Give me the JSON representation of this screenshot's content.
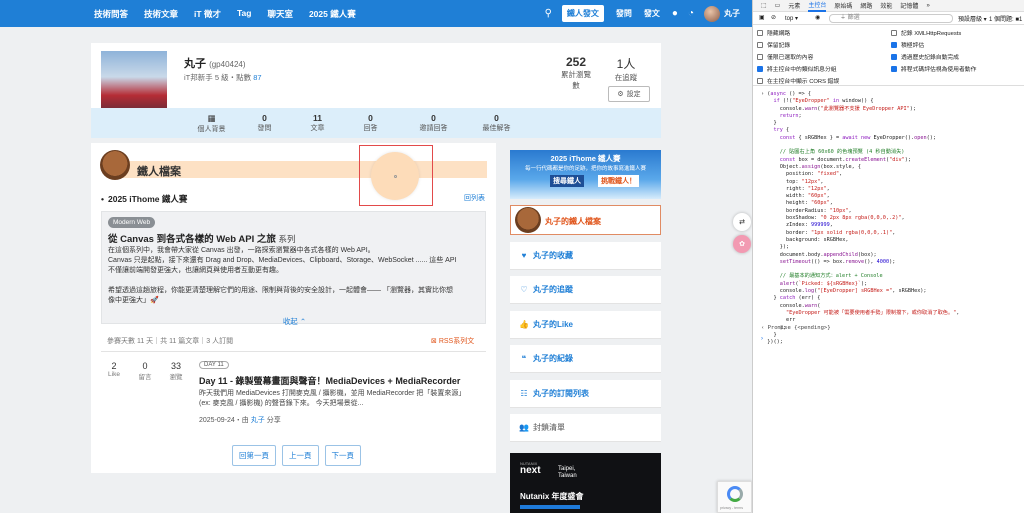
{
  "nav": {
    "links": [
      "技術問答",
      "技術文章",
      "iT 徵才",
      "Tag",
      "聊天室",
      "2025 鐵人賽"
    ],
    "post_label": "鐵人發文",
    "publish_label": "發問",
    "post_menu_label": "發文",
    "user_label": "丸子"
  },
  "profile": {
    "name": "丸子",
    "handle": "(gp40424)",
    "level": "iT邦新手 5 級・點數",
    "points": "87",
    "views_count": "252",
    "views_label": "累計瀏覽數",
    "tracked_count": "1人",
    "tracked_label": "在追蹤",
    "settings_label": "設定",
    "stats": [
      {
        "n": "",
        "l": "個人背景"
      },
      {
        "n": "0",
        "l": "發問"
      },
      {
        "n": "11",
        "l": "文章"
      },
      {
        "n": "0",
        "l": "回答"
      },
      {
        "n": "0",
        "l": "邀請回答"
      },
      {
        "n": "0",
        "l": "最佳解答"
      }
    ]
  },
  "ironman": {
    "section_title": "鐵人檔案",
    "series_heading": "2025 iThome 鐵人賽",
    "back_link": "回列表",
    "tag": "Modern Web",
    "series_title": "從 Canvas 到各式各樣的 Web API 之旅",
    "series_suffix": "系列",
    "series_desc": "在這個系列中，我會帶大家從 Canvas 出發，一路探索瀏覽器中各式各樣的 Web API。\nCanvas 只是起點，接下來還有 Drag and Drop、MediaDevices、Clipboard、Storage、WebSocket ...... 這些 API\n不僅讓前端開發更強大，也讓網頁與使用者互動更有趣。\n\n希望透過這趟旅程，你能更清楚理解它們的用途、限制與背後的安全設計，一起體會—— 「瀏覽器，其實比你想\n像中更強大」🚀",
    "collapse": "收起 ⌃",
    "meta": "參賽天數 11 天｜共 11 篇文章｜3 人訂閱",
    "rss": "RSS系列文",
    "article": {
      "like_n": "2",
      "like_l": "Like",
      "reply_n": "0",
      "reply_l": "留言",
      "view_n": "33",
      "view_l": "瀏覽",
      "day": "DAY 11",
      "title": "Day 11 - 錄製螢幕畫面與聲音！MediaDevices + MediaRecorder",
      "excerpt": "昨天我們用 MediaDevices 打開麥克風 / 攝影機，並用 MediaRecorder 把「裝置來源」\n(ex: 麥克風 / 攝影機) 的聲音錄下來。 今天把場景從...",
      "date": "2025-09-24・由",
      "author": "丸子",
      "share": "分享"
    },
    "pager": [
      "回第一頁",
      "上一頁",
      "下一頁"
    ]
  },
  "sidebar": {
    "banner_title": "2025 iThome 鐵人賽",
    "banner_sub": "每一行代碼都是你的足跡，把你的故事寫進鐵人賽",
    "banner_a": "搜尋鐵人",
    "banner_b": "挑戰鐵人！",
    "profile_link": "丸子的鐵人檔案",
    "items": [
      {
        "icon": "♥",
        "label": "丸子的收藏"
      },
      {
        "icon": "♡",
        "label": "丸子的追蹤"
      },
      {
        "icon": "👍",
        "label": "丸子的Like"
      },
      {
        "icon": "❝",
        "label": "丸子的紀錄"
      },
      {
        "icon": "☷",
        "label": "丸子的訂閱列表"
      },
      {
        "icon": "👥",
        "label": "封鎖清單"
      }
    ],
    "ad_small": "NUTANIX",
    "ad_logo": "next",
    "ad_place": "Taipei,\nTaiwan",
    "ad_title": "Nutanix 年度盛會"
  },
  "devtools": {
    "tabs": [
      "元素",
      "主控台",
      "原始碼",
      "網路",
      "效能",
      "記憶體"
    ],
    "active_tab": "主控台",
    "context": "top ▾",
    "filter_placeholder": "篩選",
    "levels": "預設層級 ▾",
    "issues": "1 個問題: ■1",
    "options_left": [
      "隱藏網路",
      "保留記錄",
      "僅限已選取的內容",
      "將主控台中的類似訊息分組",
      "在主控台中顯示 CORS 錯誤"
    ],
    "options_right": [
      "記錄 XMLHttpRequests",
      "積極評估",
      "透過歷史記錄自動完成",
      "將程式碼評估視為使用者動作"
    ],
    "checked_left": [
      false,
      false,
      false,
      true,
      false
    ],
    "checked_right": [
      false,
      true,
      true,
      true
    ],
    "promise_text": "Promise {<pending>}"
  },
  "colors": {
    "brand": "#1f7fd6",
    "accent": "#e0551b",
    "profile_band": "#fde1c4",
    "picked_circle": "#fddcb9"
  }
}
